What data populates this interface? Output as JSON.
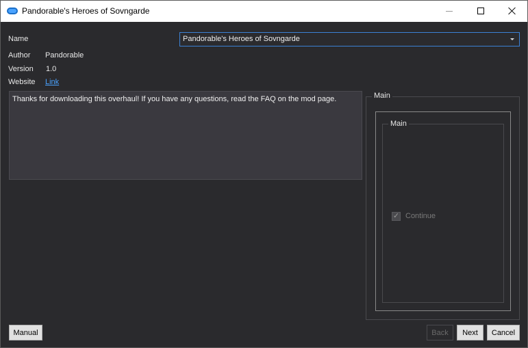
{
  "window": {
    "title": "Pandorable's Heroes of Sovngarde"
  },
  "fields": {
    "name_label": "Name",
    "name_value": "Pandorable's Heroes of Sovngarde",
    "author_label": "Author",
    "author_value": "Pandorable",
    "version_label": "Version",
    "version_value": "1.0",
    "website_label": "Website",
    "website_value": "Link"
  },
  "description": "Thanks for downloading this overhaul! If you have any questions, read the FAQ on the mod page.",
  "options_group": {
    "outer_title": "Main",
    "inner_title": "Main",
    "checkbox_label": "Continue",
    "checkbox_checked": true
  },
  "buttons": {
    "manual": "Manual",
    "back": "Back",
    "next": "Next",
    "cancel": "Cancel"
  },
  "icons": {
    "app": "app-icon",
    "minimize": "minimize-icon",
    "maximize": "maximize-icon",
    "close": "close-icon",
    "dropdown": "chevron-down-icon",
    "check": "checkmark-icon"
  },
  "colors": {
    "background": "#2a2a2d",
    "accent": "#3c82d6",
    "link": "#4aa3ff"
  }
}
